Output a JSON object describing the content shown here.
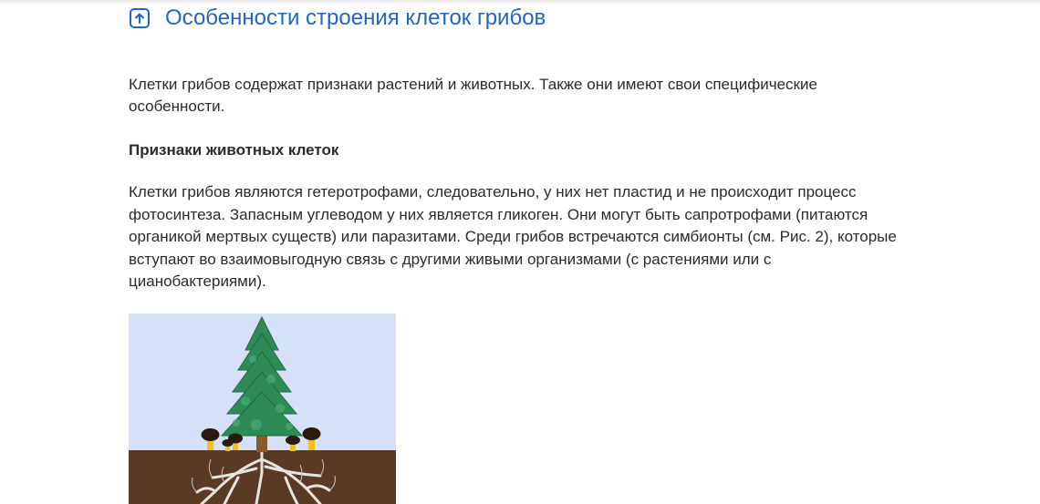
{
  "section": {
    "title": "Особенности строения клеток грибов",
    "icon": "arrow-up-square-icon",
    "accent_color": "#2265c3"
  },
  "paragraphs": {
    "intro": "Клетки грибов содержат признаки растений и животных. Также они имеют свои специфические особенности.",
    "subheading": "Признаки животных клеток",
    "animal_features": "Клетки грибов являются гетеротрофами, следовательно, у них нет пластид и не происходит процесс фотосинтеза. Запасным углеводом у них является гликоген. Они могут быть сапротрофами (питаются органикой мертвых существ) или паразитами. Среди грибов встречаются симбионты (см. Рис. 2), которые вступают во взаимовыгодную связь с другими живыми организмами (с растениями или с цианобактериями)."
  },
  "figure": {
    "depicts": "tree-with-mushrooms-mycorrhiza-illustration",
    "sky_color": "#d6e0f7",
    "soil_color": "#5b3a24",
    "tree_color": "#2e8b57"
  }
}
